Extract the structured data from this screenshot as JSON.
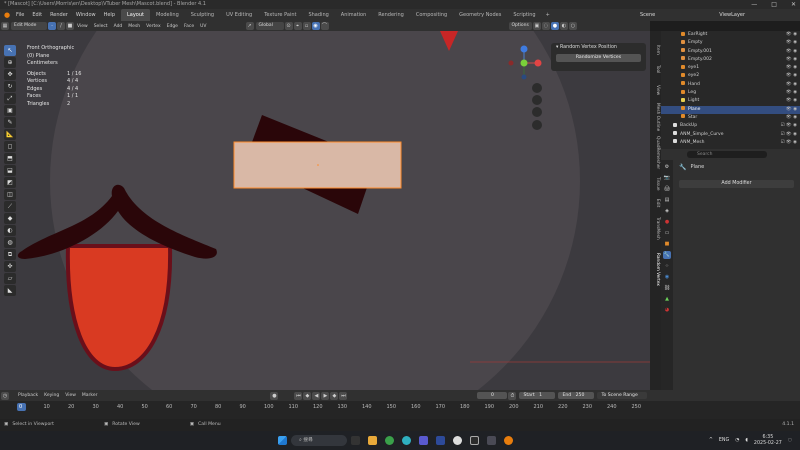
{
  "window": {
    "title": "* [Mascot] [C:\\Users\\Morris\\en\\Desktop\\VTuber Mesh\\Mascot.blend] - Blender 4.1",
    "controls": [
      "—",
      "□",
      "✕"
    ]
  },
  "menubar": {
    "menus": [
      "File",
      "Edit",
      "Render",
      "Window",
      "Help"
    ],
    "workspaces": [
      "Layout",
      "Modeling",
      "Sculpting",
      "UV Editing",
      "Texture Paint",
      "Shading",
      "Animation",
      "Rendering",
      "Compositing",
      "Geometry Nodes",
      "Scripting"
    ],
    "active_workspace": "Layout",
    "scene_label": "Scene",
    "view_layer_label": "ViewLayer"
  },
  "viewport_header": {
    "mode": "Edit Mode",
    "menus": [
      "View",
      "Select",
      "Add",
      "Mesh",
      "Vertex",
      "Edge",
      "Face",
      "UV"
    ],
    "transform": "Global",
    "options": "Options"
  },
  "viewport_info": {
    "view": "Front Orthographic",
    "object": "(0) Plane",
    "units": "Centimeters",
    "stats": [
      {
        "label": "Objects",
        "value": "1 / 16"
      },
      {
        "label": "Vertices",
        "value": "4 / 4"
      },
      {
        "label": "Edges",
        "value": "4 / 4"
      },
      {
        "label": "Faces",
        "value": "1 / 1"
      },
      {
        "label": "Triangles",
        "value": "2"
      }
    ]
  },
  "npanel": {
    "header": "Random Vertex Position",
    "button": "Randomize Vertices"
  },
  "side_tabs": [
    "Item",
    "Tool",
    "View",
    "Mesh Outline",
    "QuadRemesher",
    "Tissue",
    "Edit",
    "TransMesh",
    "Random Vertex"
  ],
  "outliner": {
    "items": [
      {
        "name": "EarRight",
        "icon": "mesh"
      },
      {
        "name": "Empty",
        "icon": "empty"
      },
      {
        "name": "Empty.001",
        "icon": "empty"
      },
      {
        "name": "Empty.002",
        "icon": "empty"
      },
      {
        "name": "eye1",
        "icon": "mesh"
      },
      {
        "name": "eye2",
        "icon": "mesh"
      },
      {
        "name": "Hand",
        "icon": "mesh"
      },
      {
        "name": "Leg",
        "icon": "mesh"
      },
      {
        "name": "Light",
        "icon": "light"
      },
      {
        "name": "Plane",
        "icon": "mesh",
        "selected": true
      },
      {
        "name": "Star",
        "icon": "mesh"
      },
      {
        "name": "BackUp",
        "icon": "collection"
      },
      {
        "name": "ANM_Simple_Curve",
        "icon": "collection"
      },
      {
        "name": "ANM_Mesh",
        "icon": "collection"
      }
    ]
  },
  "properties": {
    "search_placeholder": "Search",
    "object_name": "Plane",
    "add_modifier": "Add Modifier"
  },
  "timeline": {
    "menus": [
      "Playback",
      "Keying",
      "View",
      "Marker"
    ],
    "current_frame": "0",
    "start_label": "Start",
    "start": "1",
    "end_label": "End",
    "end": "250",
    "range_label": "To Scene Range",
    "ticks": [
      "0",
      "10",
      "20",
      "30",
      "40",
      "50",
      "60",
      "70",
      "80",
      "90",
      "100",
      "110",
      "120",
      "130",
      "140",
      "150",
      "160",
      "170",
      "180",
      "190",
      "200",
      "210",
      "220",
      "230",
      "240",
      "250"
    ]
  },
  "statusbar": {
    "left": "Select in Viewport",
    "middle": "Rotate View",
    "right": "Call Menu",
    "version": "4.1.1"
  },
  "taskbar": {
    "search_placeholder": "搜尋",
    "lang": "ENG",
    "time": "6:35",
    "date": "2025-02-27"
  },
  "colors": {
    "accent": "#4772b3",
    "viewport_bg": "#3c3a3f",
    "mascot_red": "#d93a22",
    "mascot_dark": "#2a0609",
    "plane_fill": "#d9b8a6",
    "plane_edge": "#ff8a2a"
  }
}
